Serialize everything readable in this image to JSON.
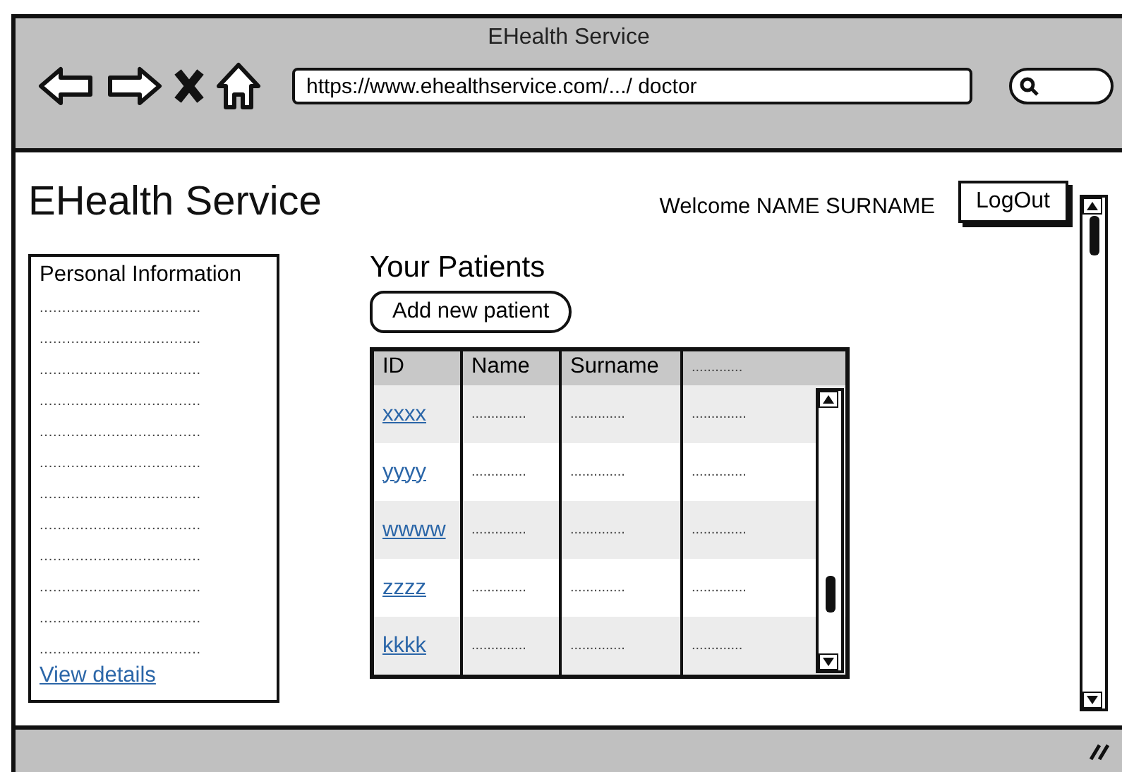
{
  "window": {
    "title": "EHealth Service",
    "url": "https://www.ehealthservice.com/.../ doctor"
  },
  "header": {
    "site_title": "EHealth Service",
    "welcome": "Welcome NAME SURNAME",
    "logout_button": "LogOut"
  },
  "sidebar": {
    "title": "Personal Information",
    "lines": [
      "....................................",
      "....................................",
      "....................................",
      "....................................",
      "....................................",
      "....................................",
      "....................................",
      "....................................",
      "....................................",
      "....................................",
      "....................................",
      "...................................."
    ],
    "link": "View details"
  },
  "patients": {
    "title": "Your Patients",
    "add_button": "Add new patient",
    "table": {
      "columns": [
        "ID",
        "Name",
        "Surname",
        "............."
      ],
      "rows": [
        {
          "cells": [
            "xxxx",
            "..............",
            "..............",
            ".............."
          ]
        },
        {
          "cells": [
            "yyyy",
            "..............",
            "..............",
            ".............."
          ]
        },
        {
          "cells": [
            "wwww",
            "..............",
            "..............",
            ".............."
          ]
        },
        {
          "cells": [
            "zzzz",
            "..............",
            "..............",
            ".............."
          ]
        },
        {
          "cells": [
            "kkkk",
            "..............",
            "..............",
            "............."
          ]
        }
      ]
    }
  }
}
